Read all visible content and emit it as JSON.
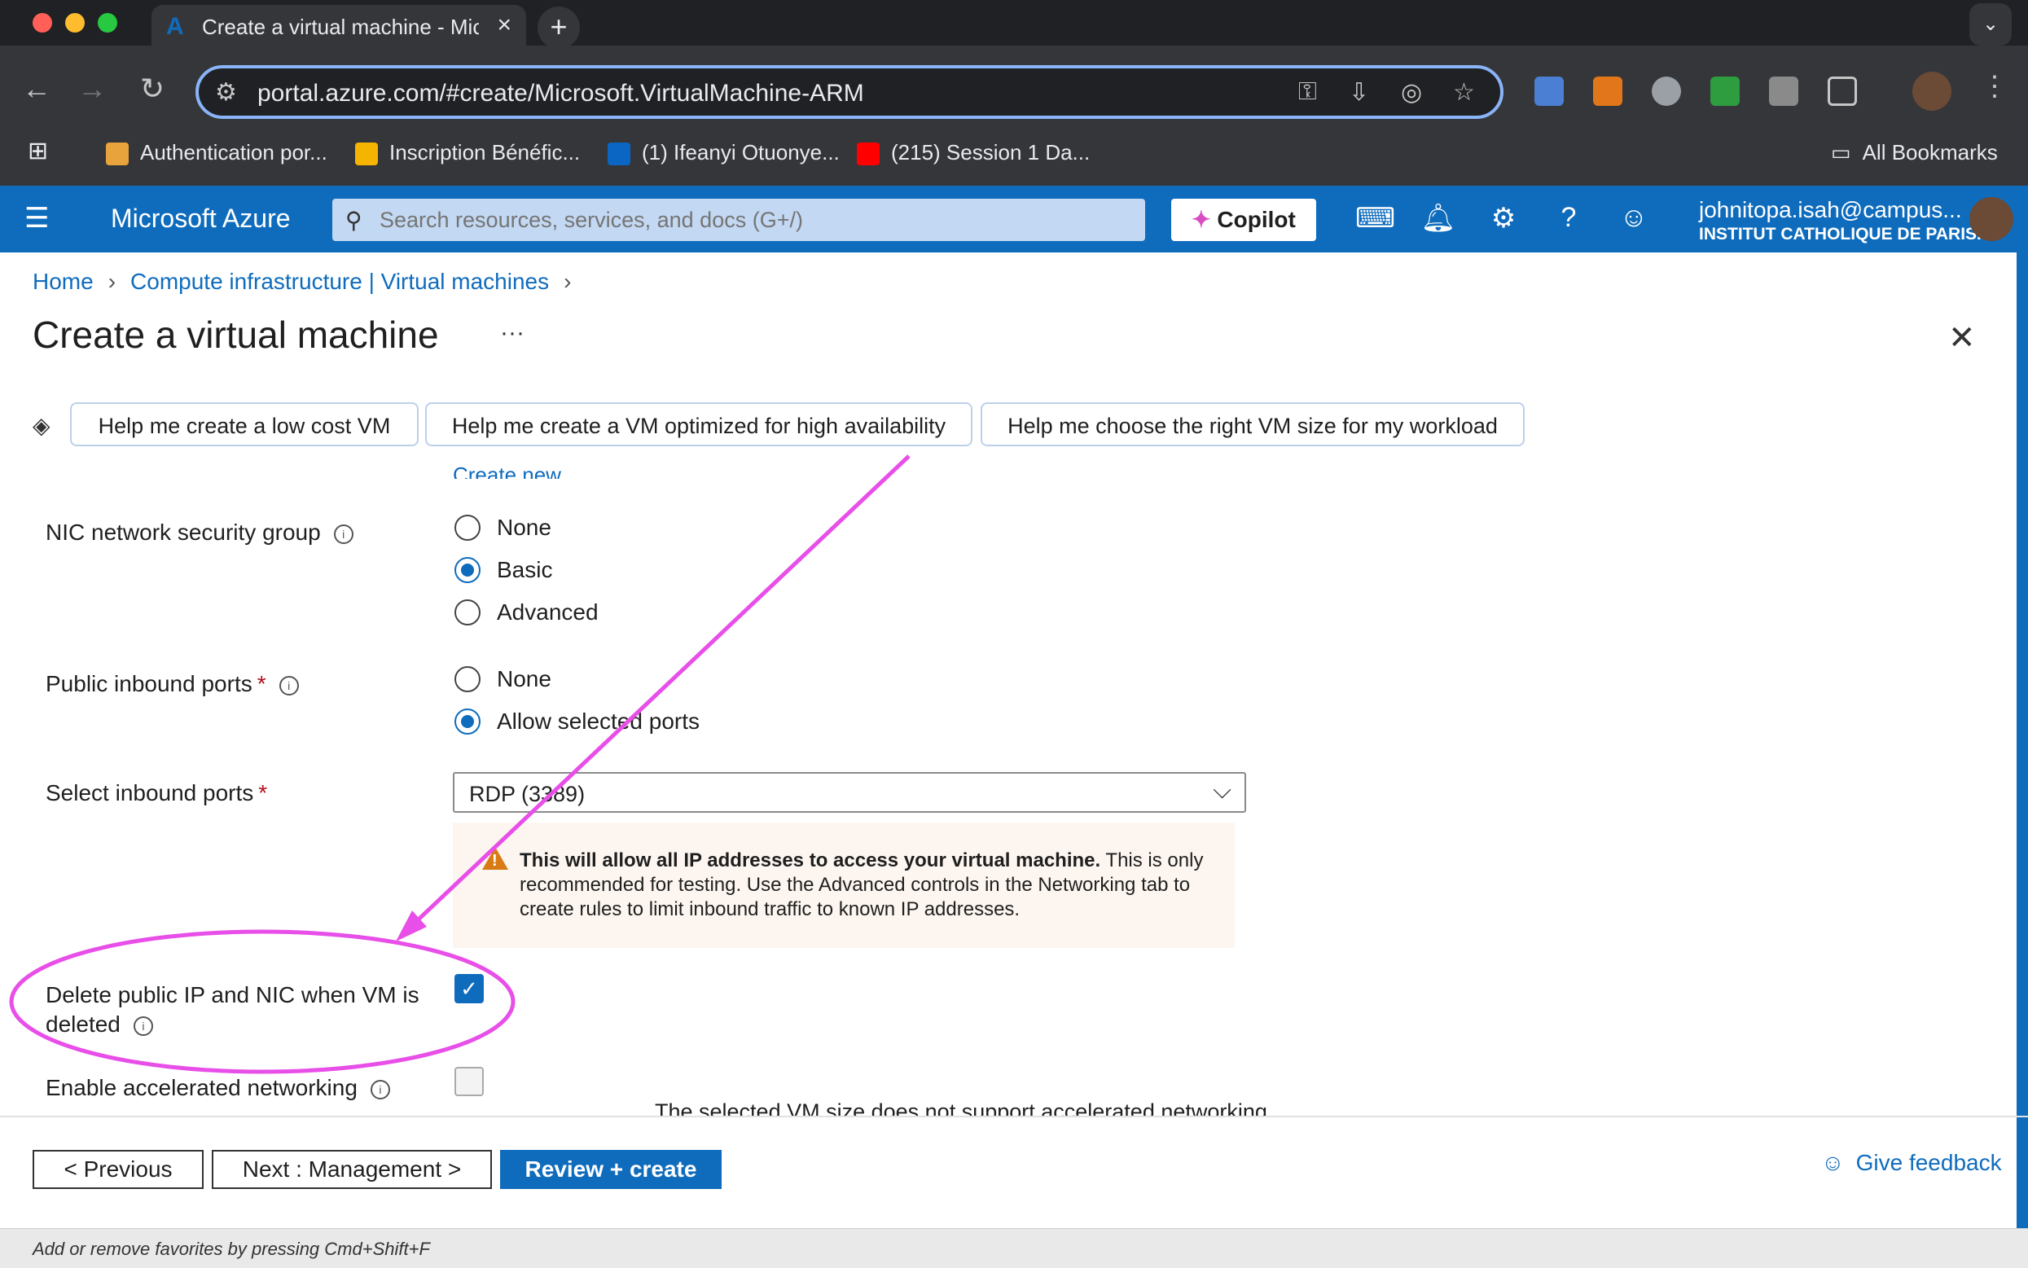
{
  "browser": {
    "tab_title": "Create a virtual machine - Microsoft Azure",
    "tab_close": "×",
    "new_tab": "+",
    "tab_search": "⌄",
    "url": "portal.azure.com/#create/Microsoft.VirtualMachine-ARM",
    "bookmarks": [
      {
        "label": "Authentication por...",
        "color": "#e8a33d"
      },
      {
        "label": "Inscription Bénéfic...",
        "color": "#f4b400"
      },
      {
        "label": "(1) Ifeanyi Otuonye...",
        "color": "#0a66c2"
      },
      {
        "label": "(215) Session 1 Da...",
        "color": "#ff0000"
      }
    ],
    "all_bookmarks": "All Bookmarks"
  },
  "azure": {
    "brand": "Microsoft Azure",
    "search_placeholder": "Search resources, services, and docs (G+/)",
    "copilot": "Copilot",
    "user_email": "johnitopa.isah@campus...",
    "user_org": "INSTITUT CATHOLIQUE DE PARIS..."
  },
  "breadcrumb": {
    "home": "Home",
    "compute": "Compute infrastructure | Virtual machines"
  },
  "page": {
    "title": "Create a virtual machine",
    "more": "···",
    "close": "✕"
  },
  "suggestions": [
    "Help me create a low cost VM",
    "Help me create a VM optimized for high availability",
    "Help me choose the right VM size for my workload"
  ],
  "form": {
    "cutoff_link": "Create new",
    "nic_nsg": {
      "label": "NIC network security group",
      "options": [
        "None",
        "Basic",
        "Advanced"
      ],
      "selected": "Basic"
    },
    "public_ports": {
      "label": "Public inbound ports",
      "required": "*",
      "options": [
        "None",
        "Allow selected ports"
      ],
      "selected": "Allow selected ports"
    },
    "inbound_ports": {
      "label": "Select inbound ports",
      "required": "*",
      "value": "RDP (3389)"
    },
    "warning": {
      "bold": "This will allow all IP addresses to access your virtual machine.",
      "text": " This is only recommended for testing.  Use the Advanced controls in the Networking tab to create rules to limit inbound traffic to known IP addresses."
    },
    "delete_ip": {
      "label_line1": "Delete public IP and NIC when VM is",
      "label_line2": "deleted",
      "checked": true
    },
    "accel": {
      "label": "Enable accelerated networking",
      "checked": false,
      "note": "The selected VM size does not support accelerated networking."
    }
  },
  "footer": {
    "previous": "< Previous",
    "next": "Next : Management >",
    "review": "Review + create",
    "feedback": "Give feedback"
  },
  "status": "Add or remove favorites by pressing Cmd+Shift+F",
  "colors": {
    "accent": "#0f6cbd",
    "annotation": "#e84ee8",
    "warning": "#d97b14"
  }
}
